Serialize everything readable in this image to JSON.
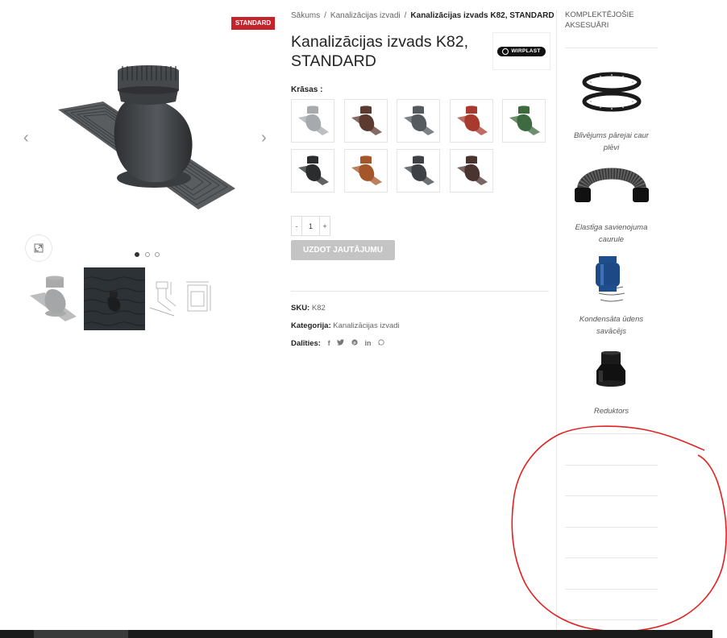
{
  "product": {
    "badge": "STANDARD",
    "title": "Kanalizācijas izvads K82, STANDARD",
    "brand_logo": "WIRPLAST",
    "colors_label": "Krāsas",
    "colors": [
      "#a7aaad",
      "#5c3a30",
      "#555a5e",
      "#a8392e",
      "#3d6b3f",
      "#2a2c2e",
      "#a5552a",
      "#3e4246",
      "#4a3430"
    ],
    "quantity": "1",
    "quantity_minus": "-",
    "quantity_plus": "+",
    "ask_button": "UZDOT JAUTĀJUMU",
    "sku_label": "SKU:",
    "sku_value": "K82",
    "category_label": "Kategorija:",
    "category_value": "Kanalizācijas izvadi",
    "share_label": "Dalīties:",
    "share_icons": [
      "facebook-icon",
      "twitter-icon",
      "pinterest-icon",
      "linkedin-icon",
      "whatsapp-icon"
    ]
  },
  "breadcrumb": {
    "home": "Sākums",
    "category": "Kanalizācijas izvadi",
    "current": "Kanalizācijas izvads K82, STANDARD"
  },
  "gallery": {
    "slide_count": 3,
    "active_slide": 1
  },
  "sidebar": {
    "title": "KOMPLEKTĒJOŠIE AKSESUĀRI",
    "items": [
      {
        "label": "Blīvējums pārejai caur plēvi"
      },
      {
        "label": "Elastīga savienojuma caurule"
      },
      {
        "label": "Kondensāta ūdens savācējs"
      },
      {
        "label": "Reduktors"
      }
    ]
  },
  "colors": {
    "accent": "#c4232b",
    "button_disabled": "#c4c4c4",
    "footer": "#1b1b1b"
  }
}
